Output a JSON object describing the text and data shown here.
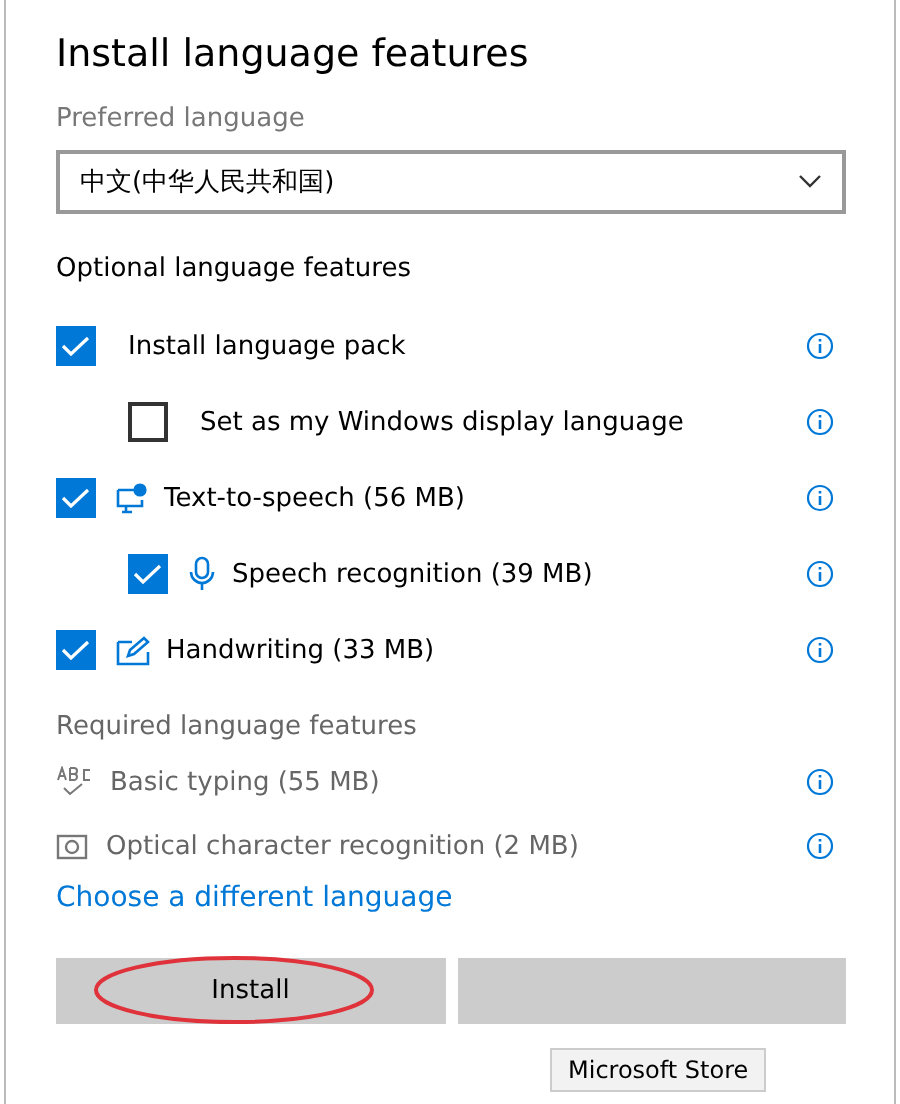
{
  "title": "Install language features",
  "preferred_language": {
    "label": "Preferred language",
    "value": "中文(中华人民共和国)"
  },
  "optional": {
    "heading": "Optional language features",
    "items": [
      {
        "label": "Install language pack",
        "checked": true,
        "kind": "plain",
        "nested": false
      },
      {
        "label": "Set as my Windows display language",
        "checked": false,
        "kind": "plain",
        "nested": true
      },
      {
        "label": "Text-to-speech (56 MB)",
        "checked": true,
        "kind": "speech",
        "nested": false
      },
      {
        "label": "Speech recognition (39 MB)",
        "checked": true,
        "kind": "mic",
        "nested": true
      },
      {
        "label": "Handwriting (33 MB)",
        "checked": true,
        "kind": "pen",
        "nested": false
      }
    ]
  },
  "required": {
    "heading": "Required language features",
    "items": [
      {
        "label": "Basic typing (55 MB)",
        "kind": "abc"
      },
      {
        "label": "Optical character recognition (2 MB)",
        "kind": "ocr"
      }
    ]
  },
  "link": "Choose a different language",
  "buttons": [
    {
      "kind": "install",
      "label": "Install",
      "highlighted": true
    },
    {
      "kind": "cancel",
      "highlighted": false
    }
  ],
  "tooltip": "Microsoft Store"
}
